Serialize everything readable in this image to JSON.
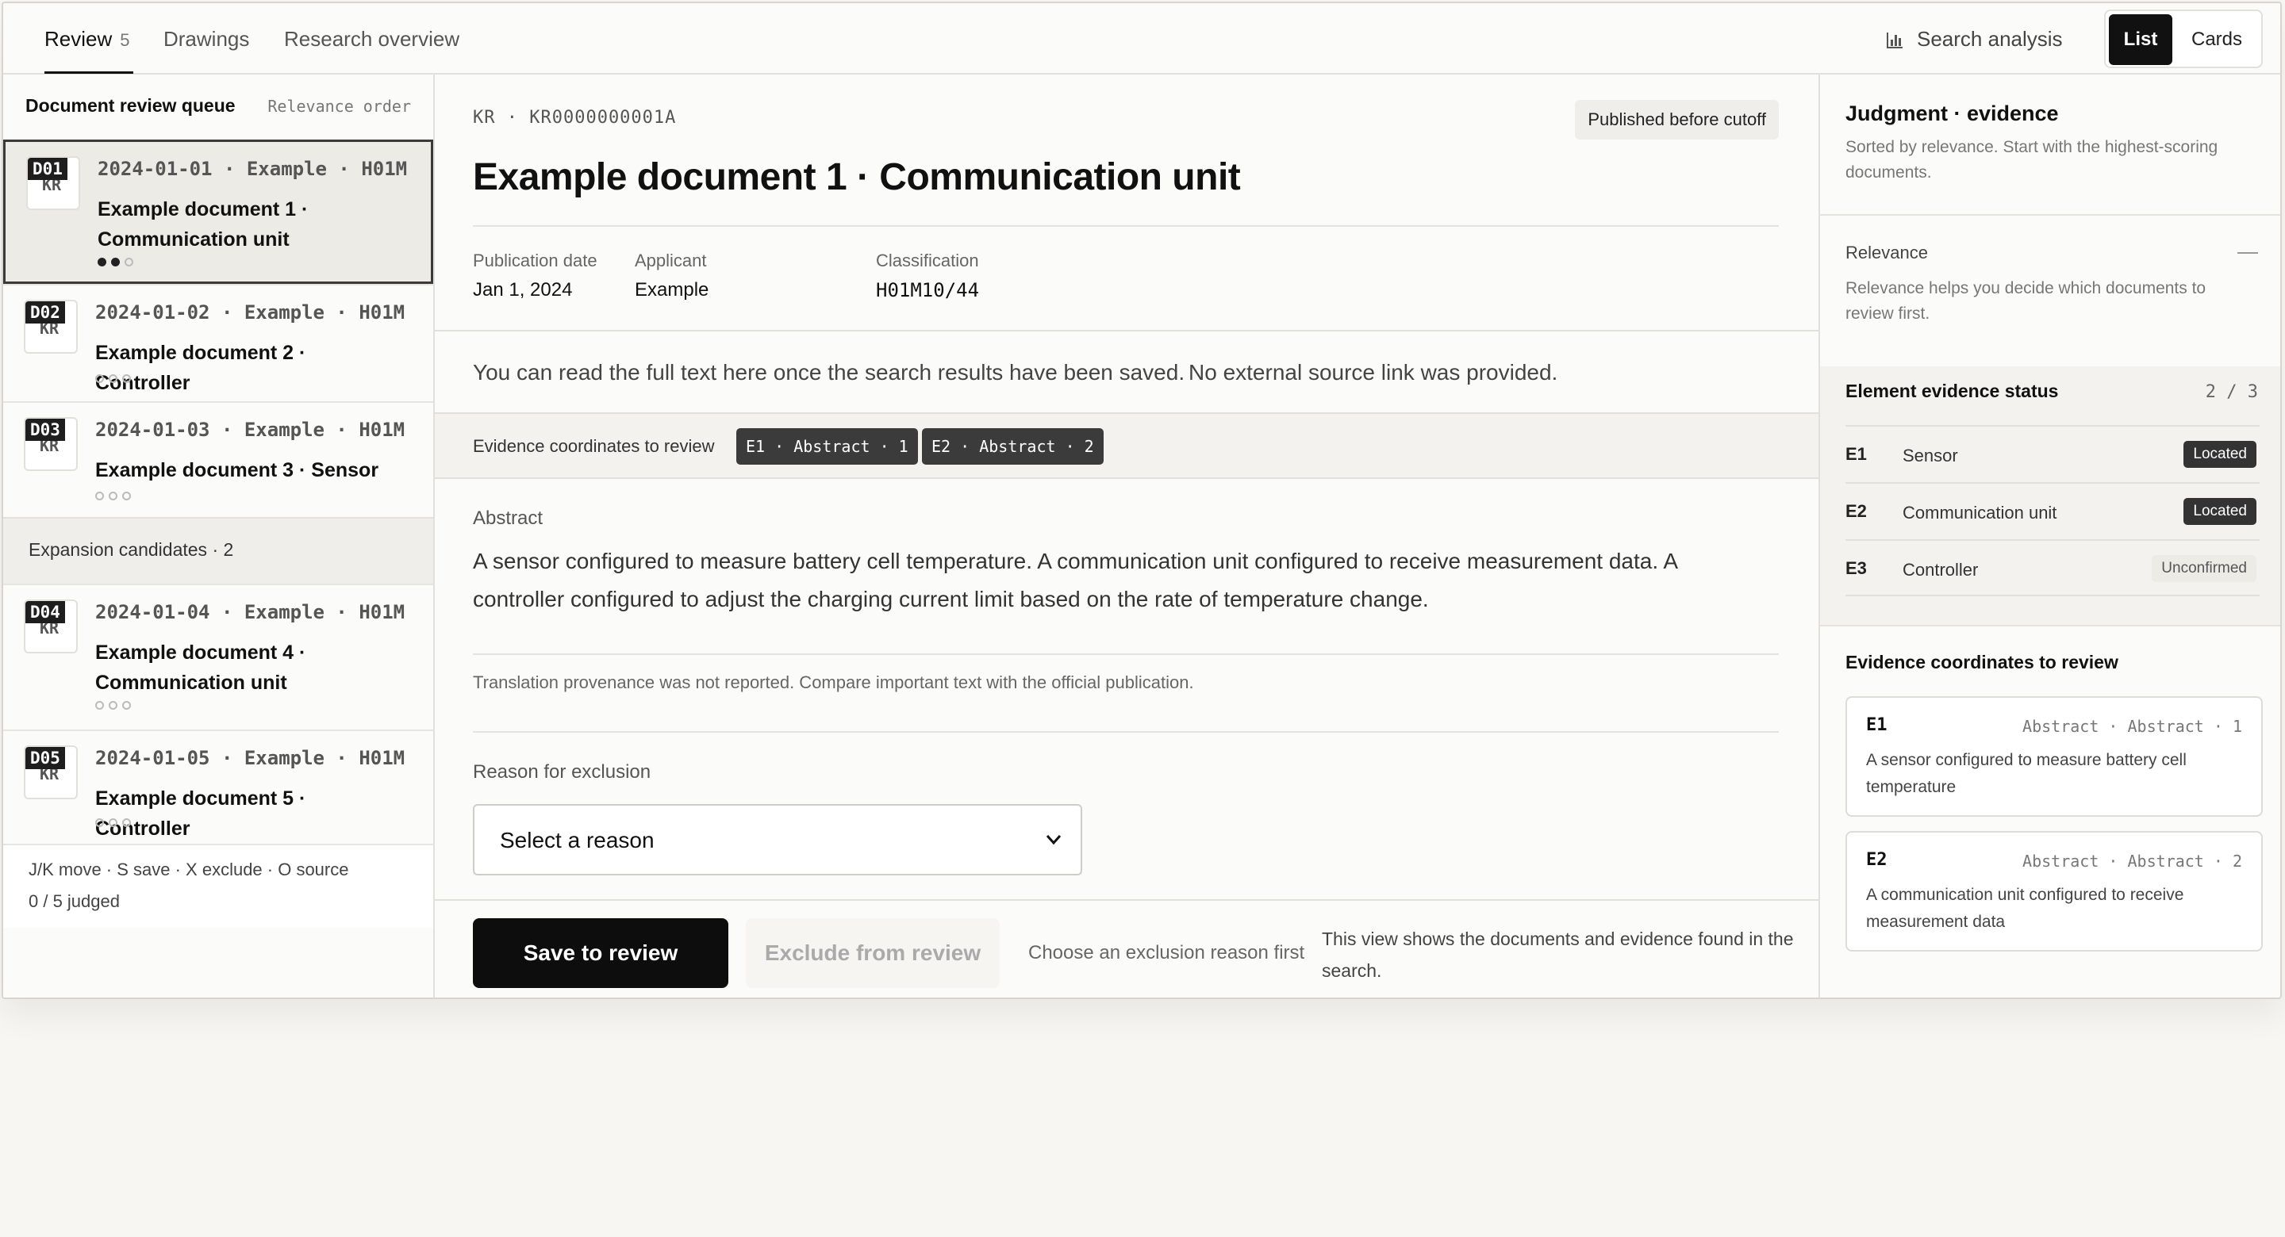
{
  "tabs": [
    {
      "label": "Review",
      "count": "5"
    },
    {
      "label": "Drawings"
    },
    {
      "label": "Research overview"
    }
  ],
  "header": {
    "search_analysis": "Search analysis",
    "view_list": "List",
    "view_cards": "Cards"
  },
  "sidebar": {
    "title": "Document review queue",
    "sort": "Relevance order",
    "documents": [
      {
        "code": "D01",
        "country": "KR",
        "meta": "2024-01-01 · Example · H01M",
        "title": "Example document 1 · Communication unit",
        "dots": [
          true,
          true,
          false
        ]
      },
      {
        "code": "D02",
        "country": "KR",
        "meta": "2024-01-02 · Example · H01M",
        "title": "Example document 2 · Controller",
        "dots": [
          false,
          false,
          false
        ]
      },
      {
        "code": "D03",
        "country": "KR",
        "meta": "2024-01-03 · Example · H01M",
        "title": "Example document 3 · Sensor",
        "dots": [
          false,
          false,
          false
        ]
      },
      {
        "code": "D04",
        "country": "KR",
        "meta": "2024-01-04 · Example · H01M",
        "title": "Example document 4 · Communication unit",
        "dots": [
          false,
          false,
          false
        ]
      },
      {
        "code": "D05",
        "country": "KR",
        "meta": "2024-01-05 · Example · H01M",
        "title": "Example document 5 · Controller",
        "dots": [
          false,
          false,
          false
        ]
      }
    ],
    "expansion": "Expansion candidates · 2",
    "shortcuts": "J/K move · S save · X exclude · O source",
    "judged": "0 / 5 judged"
  },
  "main": {
    "doc_number": "KR · KR0000000001A",
    "cutoff_badge": "Published before cutoff",
    "title": "Example document 1 · Communication unit",
    "fields": {
      "pub_label": "Publication date",
      "pub_value": "Jan 1, 2024",
      "applicant_label": "Applicant",
      "applicant_value": "Example",
      "class_label": "Classification",
      "class_value": "H01M10/44"
    },
    "fulltext_note": "You can read the full text here once the search results have been saved.",
    "source_note": "No external source link was provided.",
    "coords_label": "Evidence coordinates to review",
    "chips": [
      "E1 · Abstract · 1",
      "E2 · Abstract · 2"
    ],
    "abstract_label": "Abstract",
    "abstract": "A sensor configured to measure battery cell temperature. A communication unit configured to receive measurement data. A controller configured to adjust the charging current limit based on the rate of temperature change.",
    "provenance": "Translation provenance was not reported. Compare important text with the official publication.",
    "exclusion_label": "Reason for exclusion",
    "exclusion_select": "Select a reason",
    "save_button": "Save to review",
    "exclude_button": "Exclude from review",
    "exclude_hint": "Choose an exclusion reason first",
    "view_note": "This view shows the documents and evidence found in the search."
  },
  "right": {
    "title": "Judgment · evidence",
    "subtitle": "Sorted by relevance. Start with the highest-scoring documents.",
    "relevance_label": "Relevance",
    "relevance_desc": "Relevance helps you decide which documents to review first.",
    "evidence_title": "Element evidence status",
    "evidence_count": "2 / 3",
    "elements": [
      {
        "id": "E1",
        "name": "Sensor",
        "status": "Located"
      },
      {
        "id": "E2",
        "name": "Communication unit",
        "status": "Located"
      },
      {
        "id": "E3",
        "name": "Controller",
        "status": "Unconfirmed"
      }
    ],
    "coords_title": "Evidence coordinates to review",
    "coords": [
      {
        "id": "E1",
        "location": "Abstract · Abstract · 1",
        "text": "A sensor configured to measure battery cell temperature"
      },
      {
        "id": "E2",
        "location": "Abstract · Abstract · 2",
        "text": "A communication unit configured to receive measurement data"
      }
    ]
  }
}
